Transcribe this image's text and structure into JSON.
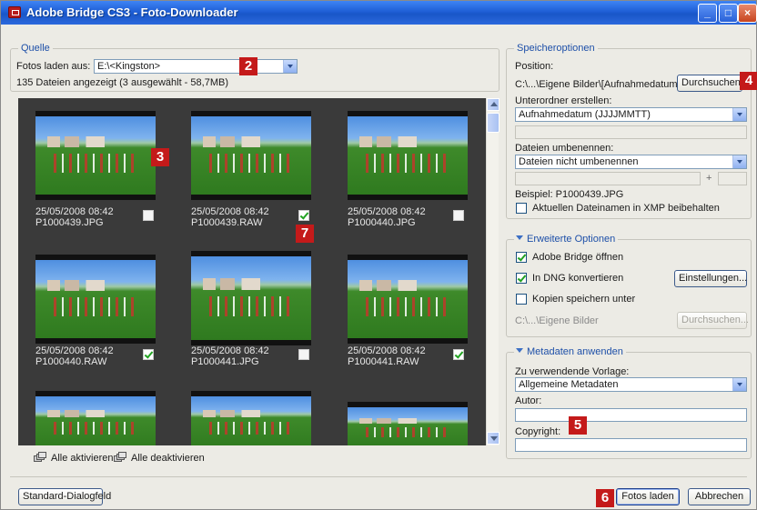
{
  "window": {
    "title": "Adobe Bridge CS3 - Foto-Downloader"
  },
  "titlebar": {
    "min": "_",
    "max": "□",
    "close": "×"
  },
  "source": {
    "legend": "Quelle",
    "load_from_label": "Fotos laden aus:",
    "load_from_value": "E:\\<Kingston>",
    "summary": "135 Dateien angezeigt (3 ausgewählt - 58,7MB)"
  },
  "thumbnails": [
    {
      "date": "25/05/2008 08:42",
      "file": "P1000439.JPG",
      "checked": false
    },
    {
      "date": "25/05/2008 08:42",
      "file": "P1000439.RAW",
      "checked": true
    },
    {
      "date": "25/05/2008 08:42",
      "file": "P1000440.JPG",
      "checked": false
    },
    {
      "date": "25/05/2008 08:42",
      "file": "P1000440.RAW",
      "checked": true
    },
    {
      "date": "25/05/2008 08:42",
      "file": "P1000441.JPG",
      "checked": false
    },
    {
      "date": "25/05/2008 08:42",
      "file": "P1000441.RAW",
      "checked": true
    }
  ],
  "thumb_actions": {
    "select_all": "Alle aktivieren",
    "deselect_all": "Alle deaktivieren"
  },
  "storage": {
    "legend": "Speicheroptionen",
    "position_label": "Position:",
    "position_value": "C:\\...\\Eigene Bilder\\[Aufnahmedatum]",
    "browse": "Durchsuchen...",
    "subfolder_label": "Unterordner erstellen:",
    "subfolder_value": "Aufnahmedatum (JJJJMMTT)",
    "rename_label": "Dateien umbenennen:",
    "rename_value": "Dateien nicht umbenennen",
    "plus": "+",
    "example": "Beispiel: P1000439.JPG",
    "keep_xmp": "Aktuellen Dateinamen in XMP beibehalten"
  },
  "advanced": {
    "legend": "Erweiterte Optionen",
    "open_bridge": "Adobe Bridge öffnen",
    "convert_dng": "In DNG konvertieren",
    "settings": "Einstellungen...",
    "save_copies": "Kopien speichern unter",
    "copies_path": "C:\\...\\Eigene Bilder",
    "browse": "Durchsuchen..."
  },
  "metadata": {
    "legend": "Metadaten anwenden",
    "template_label": "Zu verwendende Vorlage:",
    "template_value": "Allgemeine Metadaten",
    "author_label": "Autor:",
    "copyright_label": "Copyright:"
  },
  "footer": {
    "standard_dialog": "Standard-Dialogfeld",
    "load_photos": "Fotos laden",
    "cancel": "Abbrechen"
  },
  "badges": {
    "b2": "2",
    "b3": "3",
    "b4": "4",
    "b5": "5",
    "b6": "6",
    "b7": "7"
  },
  "colors": {
    "titlebar": "#1f5fd6",
    "badge": "#c41a1a",
    "thumb_bg": "#3a3a3a",
    "legend": "#1d4fa8"
  }
}
